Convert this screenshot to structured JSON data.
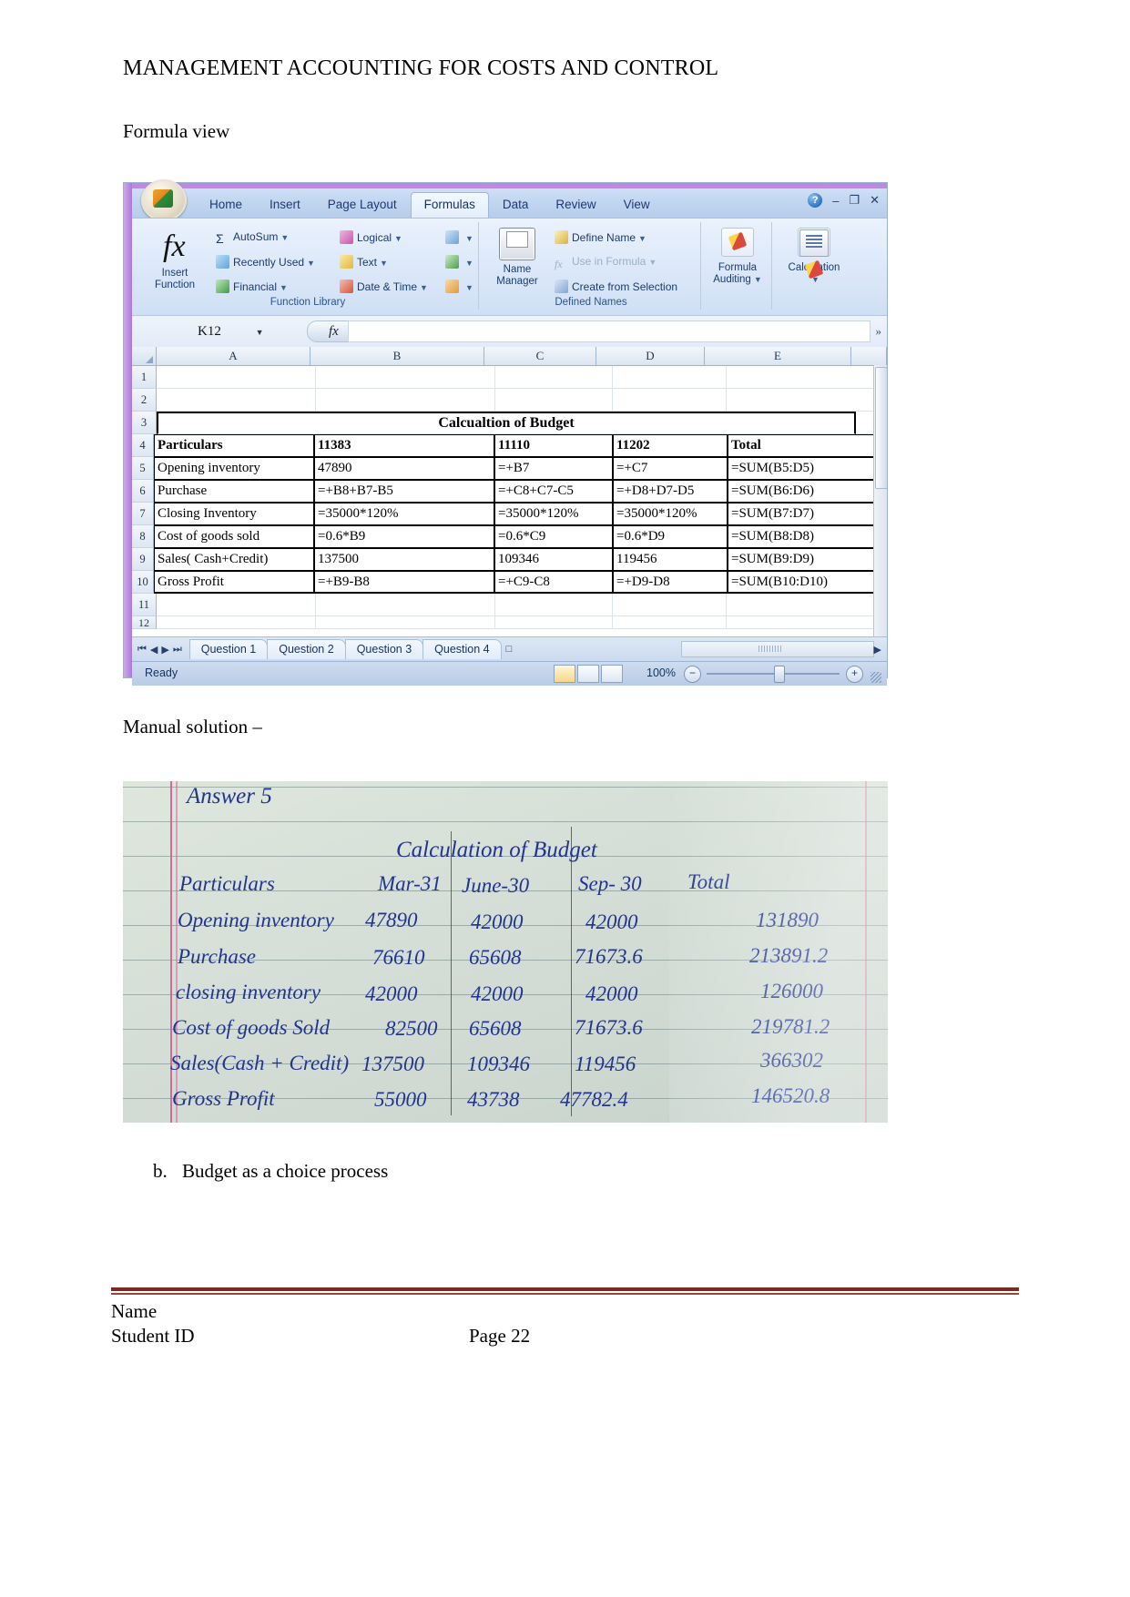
{
  "document": {
    "header_title": "MANAGEMENT ACCOUNTING FOR COSTS AND CONTROL",
    "formula_view_label": "Formula view",
    "manual_solution_label": "Manual solution –",
    "item_b_number": "b.",
    "item_b_text": "Budget as a choice process",
    "footer_name": "Name",
    "footer_student_id": "Student ID",
    "footer_page": "Page 22"
  },
  "excel": {
    "ribbon_tabs": [
      {
        "label": "Home",
        "active": false
      },
      {
        "label": "Insert",
        "active": false
      },
      {
        "label": "Page Layout",
        "active": false
      },
      {
        "label": "Formulas",
        "active": true
      },
      {
        "label": "Data",
        "active": false
      },
      {
        "label": "Review",
        "active": false
      },
      {
        "label": "View",
        "active": false
      }
    ],
    "window_buttons": {
      "help": "?",
      "minimize": "–",
      "restore": "❐",
      "close": "✕"
    },
    "groups": {
      "function_library": {
        "title": "Function Library",
        "insert_function": "Insert\nFunction",
        "insert_function_line1": "Insert",
        "insert_function_line2": "Function",
        "fx_symbol": "fx",
        "commands": [
          {
            "label": "AutoSum",
            "glyph": "Σ",
            "dropdown": true
          },
          {
            "label": "Recently Used",
            "glyph": "★",
            "dropdown": true
          },
          {
            "label": "Financial",
            "glyph": "9",
            "dropdown": true
          },
          {
            "label": "Logical",
            "glyph": "?",
            "dropdown": true
          },
          {
            "label": "Text",
            "glyph": "A",
            "dropdown": true
          },
          {
            "label": "Date & Time",
            "glyph": "☷",
            "dropdown": true
          }
        ]
      },
      "defined_names": {
        "title": "Defined Names",
        "name_manager_line1": "Name",
        "name_manager_line2": "Manager",
        "commands": [
          {
            "label": "Define Name",
            "dropdown": true,
            "disabled": false
          },
          {
            "label": "Use in Formula",
            "dropdown": true,
            "disabled": true
          },
          {
            "label": "Create from Selection",
            "dropdown": false,
            "disabled": false
          }
        ]
      },
      "formula_auditing": {
        "title": "",
        "line1": "Formula",
        "line2": "Auditing"
      },
      "calculation": {
        "title": "",
        "line1": "Calculation"
      }
    },
    "formula_bar": {
      "name_box": "K12",
      "fx_label": "fx",
      "value": ""
    },
    "columns": [
      "A",
      "B",
      "C",
      "D",
      "E"
    ],
    "rows": [
      {
        "num": "1",
        "cells": [
          "",
          "",
          "",
          "",
          ""
        ]
      },
      {
        "num": "2",
        "cells": [
          "",
          "",
          "",
          "",
          ""
        ]
      },
      {
        "num": "3",
        "title": "Calcualtion of Budget"
      },
      {
        "num": "4",
        "cells": [
          "Particulars",
          "11383",
          "11110",
          "11202",
          "Total"
        ],
        "bold": true
      },
      {
        "num": "5",
        "cells": [
          "Opening inventory",
          "47890",
          "=+B7",
          "=+C7",
          "=SUM(B5:D5)"
        ]
      },
      {
        "num": "6",
        "cells": [
          "Purchase",
          "=+B8+B7-B5",
          "=+C8+C7-C5",
          "=+D8+D7-D5",
          "=SUM(B6:D6)"
        ]
      },
      {
        "num": "7",
        "cells": [
          "Closing Inventory",
          "=35000*120%",
          "=35000*120%",
          "=35000*120%",
          "=SUM(B7:D7)"
        ]
      },
      {
        "num": "8",
        "cells": [
          "Cost of goods sold",
          "=0.6*B9",
          "=0.6*C9",
          "=0.6*D9",
          "=SUM(B8:D8)"
        ]
      },
      {
        "num": "9",
        "cells": [
          "Sales( Cash+Credit)",
          "137500",
          "109346",
          "119456",
          "=SUM(B9:D9)"
        ]
      },
      {
        "num": "10",
        "cells": [
          "Gross Profit",
          "=+B9-B8",
          "=+C9-C8",
          "=+D9-D8",
          "=SUM(B10:D10)"
        ]
      },
      {
        "num": "11",
        "cells": [
          "",
          "",
          "",
          "",
          ""
        ]
      },
      {
        "num": "12",
        "cells": [
          "",
          "",
          "",
          "",
          ""
        ]
      }
    ],
    "sheet_tabs": [
      "Question 1",
      "Question 2",
      "Question 3",
      "Question 4"
    ],
    "status": {
      "state": "Ready",
      "zoom": "100%"
    }
  },
  "handwritten": {
    "answer_label": "Answer  5",
    "title": "Calculation of Budget",
    "headers": [
      "Particulars",
      "Mar-31",
      "June-30",
      "Sep- 30",
      "Total"
    ],
    "rows": [
      {
        "label": "Opening inventory",
        "values": [
          "47890",
          "42000",
          "42000"
        ],
        "total": "131890"
      },
      {
        "label": "Purchase",
        "values": [
          "76610",
          "65608",
          "71673.6"
        ],
        "total": "213891.2"
      },
      {
        "label": "closing inventory",
        "values": [
          "42000",
          "42000",
          "42000"
        ],
        "total": "126000"
      },
      {
        "label": "Cost of goods Sold",
        "values": [
          "82500",
          "65608",
          "71673.6"
        ],
        "total": "219781.2"
      },
      {
        "label": "Sales(Cash + Credit)",
        "values": [
          "137500",
          "109346",
          "119456"
        ],
        "total": "366302"
      },
      {
        "label": "Gross Profit",
        "values": [
          "55000",
          "43738",
          "47782.4"
        ],
        "total": "146520.8"
      }
    ]
  }
}
